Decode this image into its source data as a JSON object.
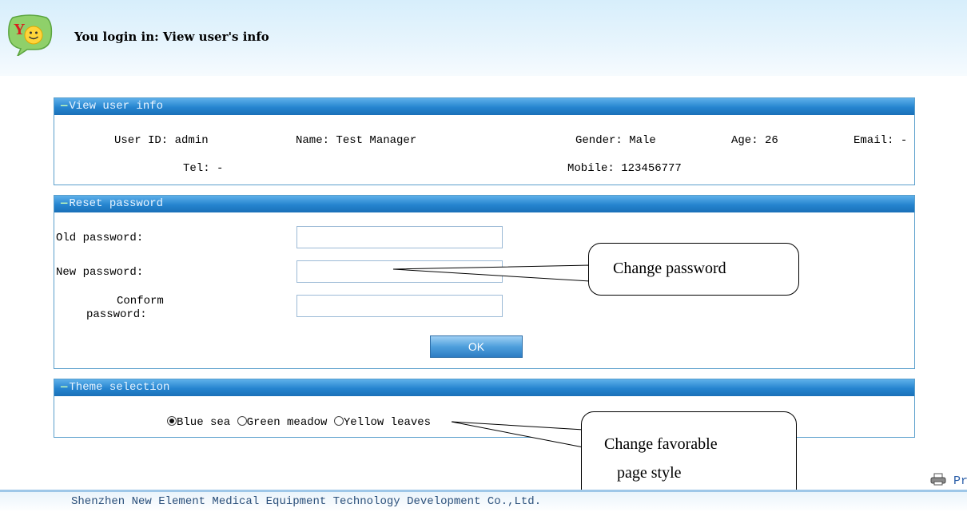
{
  "header": {
    "title": "You login in: View user's info",
    "logo_text": "Y"
  },
  "user_info": {
    "title": "View user info",
    "user_id_label": "User ID:",
    "user_id": "admin",
    "name_label": "Name:",
    "name": "Test Manager",
    "gender_label": "Gender:",
    "gender": "Male",
    "age_label": "Age:",
    "age": "26",
    "email_label": "Email:",
    "email": "-",
    "tel_label": "Tel:",
    "tel": "-",
    "mobile_label": "Mobile:",
    "mobile": "123456777"
  },
  "reset_password": {
    "title": "Reset password",
    "old_label": "Old password:",
    "old_value": "",
    "new_label": "New password:",
    "new_value": "",
    "confirm_label_1": "Conform",
    "confirm_label_2": "password:",
    "confirm_value": "",
    "ok_label": "OK"
  },
  "theme": {
    "title": "Theme selection",
    "options": [
      "Blue sea",
      "Green meadow",
      "Yellow leaves"
    ],
    "selected": "Blue sea"
  },
  "annotations": {
    "change_password": "Change password",
    "change_style_1": "Change favorable",
    "change_style_2": "page style"
  },
  "print_label": "Print...",
  "footer": "Shenzhen New Element Medical Equipment Technology Development Co.,Ltd.",
  "colors": {
    "panel_header": "#2584cf",
    "panel_border": "#5a9fcc",
    "top_bg": "#d7eefb"
  }
}
